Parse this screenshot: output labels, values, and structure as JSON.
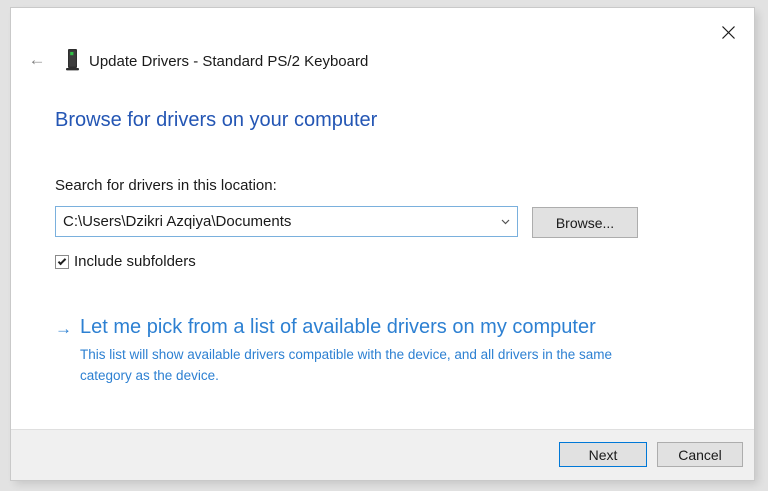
{
  "window": {
    "title": "Update Drivers - Standard PS/2 Keyboard"
  },
  "icons": {
    "back_arrow": "←",
    "pick_arrow": "→"
  },
  "main": {
    "heading": "Browse for drivers on your computer",
    "location_label": "Search for drivers in this location:",
    "location_value": "C:\\Users\\Dzikri Azqiya\\Documents",
    "browse_label": "Browse...",
    "subfolders": {
      "label": "Include subfolders",
      "checked": true
    },
    "pick": {
      "label": "Let me pick from a list of available drivers on my computer",
      "description": "This list will show available drivers compatible with the device, and all drivers in the same category as the device."
    }
  },
  "footer": {
    "next_label": "Next",
    "cancel_label": "Cancel"
  },
  "colors": {
    "heading_blue": "#2456b4",
    "link_blue": "#2d80d2",
    "combobox_border": "#7ab0dd",
    "default_button_border": "#0078d7",
    "button_bg": "#e1e1e1",
    "button_border": "#adadad",
    "footer_bg": "#f0f0f0",
    "page_bg": "#e2e2e2",
    "icon_green": "#2fc146"
  }
}
